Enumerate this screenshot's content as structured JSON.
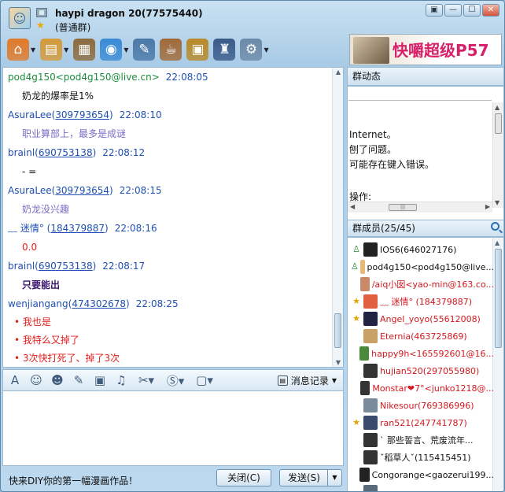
{
  "window": {
    "title": "haypi dragon 20(77575440)",
    "subtitle": "(普通群)",
    "controls": [
      "▣",
      "—",
      "☐",
      "✕"
    ]
  },
  "toolbar": {
    "items": [
      {
        "name": "home",
        "icon": "⌂",
        "color": "#e07a2a",
        "dropdown": true
      },
      {
        "name": "folder",
        "icon": "▤",
        "color": "#d49a3a",
        "dropdown": true
      },
      {
        "name": "album",
        "icon": "▦",
        "color": "#8c6b3d",
        "dropdown": false
      },
      {
        "name": "voice",
        "icon": "◉",
        "color": "#3a8bd6",
        "dropdown": true
      },
      {
        "name": "notes",
        "icon": "✎",
        "color": "#4a78a8",
        "dropdown": false
      },
      {
        "name": "coffee",
        "icon": "☕",
        "color": "#a06a3a",
        "dropdown": false
      },
      {
        "name": "tv",
        "icon": "▣",
        "color": "#b88a2a",
        "dropdown": false
      },
      {
        "name": "admin",
        "icon": "♜",
        "color": "#3a5a8a",
        "dropdown": false
      },
      {
        "name": "settings",
        "icon": "⚙",
        "color": "#6a8aa8",
        "dropdown": true
      }
    ]
  },
  "ad": {
    "text": "快嚼超级P57"
  },
  "messages": [
    {
      "sender": "pod4g150<pod4g150@live.cn>",
      "qq": "",
      "sender_color": "green",
      "time": "22:08:05",
      "body": [
        "奶龙的爆率是1%"
      ],
      "body_style": "black"
    },
    {
      "sender": "AsuraLee(",
      "qq": "309793654",
      "close": ")",
      "sender_color": "blue",
      "time": "22:08:10",
      "body": [
        "职业算部上，最多是成谜"
      ],
      "body_style": "purple"
    },
    {
      "sender": "brainl(",
      "qq": "690753138",
      "close": ")",
      "sender_color": "blue",
      "time": "22:08:12",
      "body": [
        "- ="
      ],
      "body_style": "black"
    },
    {
      "sender": "AsuraLee(",
      "qq": "309793654",
      "close": ")",
      "sender_color": "blue",
      "time": "22:08:15",
      "body": [
        "奶龙没兴趣"
      ],
      "body_style": "purple"
    },
    {
      "sender": "﹏ 迷情° (",
      "qq": "184379887",
      "close": ")",
      "sender_color": "blue",
      "time": "22:08:16",
      "body": [
        "0.0"
      ],
      "body_style": "red"
    },
    {
      "sender": "brainl(",
      "qq": "690753138",
      "close": ")",
      "sender_color": "blue",
      "time": "22:08:17",
      "body": [
        "只要能出"
      ],
      "body_style": "bold"
    },
    {
      "sender": "wenjiangang(",
      "qq": "474302678",
      "close": ")",
      "sender_color": "blue",
      "time": "22:08:25",
      "body": [
        "我也是",
        "我特么又掉了",
        "3次快打死了、掉了3次"
      ],
      "body_style": "bullet"
    }
  ],
  "format_bar": {
    "icons": [
      {
        "name": "font",
        "glyph": "A"
      },
      {
        "name": "emoji",
        "glyph": "☺"
      },
      {
        "name": "face",
        "glyph": "☻"
      },
      {
        "name": "edit",
        "glyph": "✎"
      },
      {
        "name": "image",
        "glyph": "▣"
      },
      {
        "name": "music",
        "glyph": "♫"
      },
      {
        "name": "scissors",
        "glyph": "✂▾"
      },
      {
        "name": "sogou",
        "glyph": "Ⓢ▾"
      },
      {
        "name": "screen",
        "glyph": "▢▾"
      }
    ],
    "history_label": "消息记录"
  },
  "bottom": {
    "diy_text": "快来DIY你的第一幅漫画作品！",
    "close_label": "关闭(C)",
    "send_label": "发送(S)"
  },
  "group_notice": {
    "title": "群动态",
    "lines": [
      "Internet。",
      "刨了问题。",
      "可能存在键入错误。",
      "",
      "操作:"
    ]
  },
  "members": {
    "title": "群成员(25/45)",
    "list": [
      {
        "name": "IOS6(646027176)",
        "badge": "owner",
        "avatar": "#222",
        "red": false
      },
      {
        "name": "pod4g150<pod4g150@live...",
        "badge": "owner",
        "avatar": "#e8b878",
        "red": false
      },
      {
        "name": "/aiq小囡<yao-min@163.co...",
        "badge": "",
        "avatar": "#c98a6a",
        "red": true
      },
      {
        "name": "﹏ 迷情° (184379887)",
        "badge": "admin",
        "avatar": "#e06040",
        "red": true
      },
      {
        "name": "Angel_yoyo(55612008)",
        "badge": "admin",
        "avatar": "#224",
        "red": true
      },
      {
        "name": "Eternia(463725869)",
        "badge": "",
        "avatar": "#c8a068",
        "red": true
      },
      {
        "name": "happy9h<165592601@16...",
        "badge": "",
        "avatar": "#4a8a3a",
        "red": true
      },
      {
        "name": "hujian520(297055980)",
        "badge": "",
        "avatar": "#333",
        "red": true
      },
      {
        "name": "Monstar❤7°<junko1218@...",
        "badge": "",
        "avatar": "#333",
        "red": true
      },
      {
        "name": "Nikesour(769386996)",
        "badge": "",
        "avatar": "#7a8a9a",
        "red": true
      },
      {
        "name": "ran521(247741787)",
        "badge": "admin",
        "avatar": "#3a4a6a",
        "red": true
      },
      {
        "name": "` 那些誓言、荒废流年...",
        "badge": "",
        "avatar": "#333",
        "red": false
      },
      {
        "name": "ˇ稻草人ˇ(115415451)",
        "badge": "",
        "avatar": "#333",
        "red": false
      },
      {
        "name": "Congorange<gaozerui199...",
        "badge": "",
        "avatar": "#222",
        "red": false
      },
      {
        "name": "...",
        "badge": "",
        "avatar": "#5a6a7a",
        "red": false
      }
    ]
  }
}
